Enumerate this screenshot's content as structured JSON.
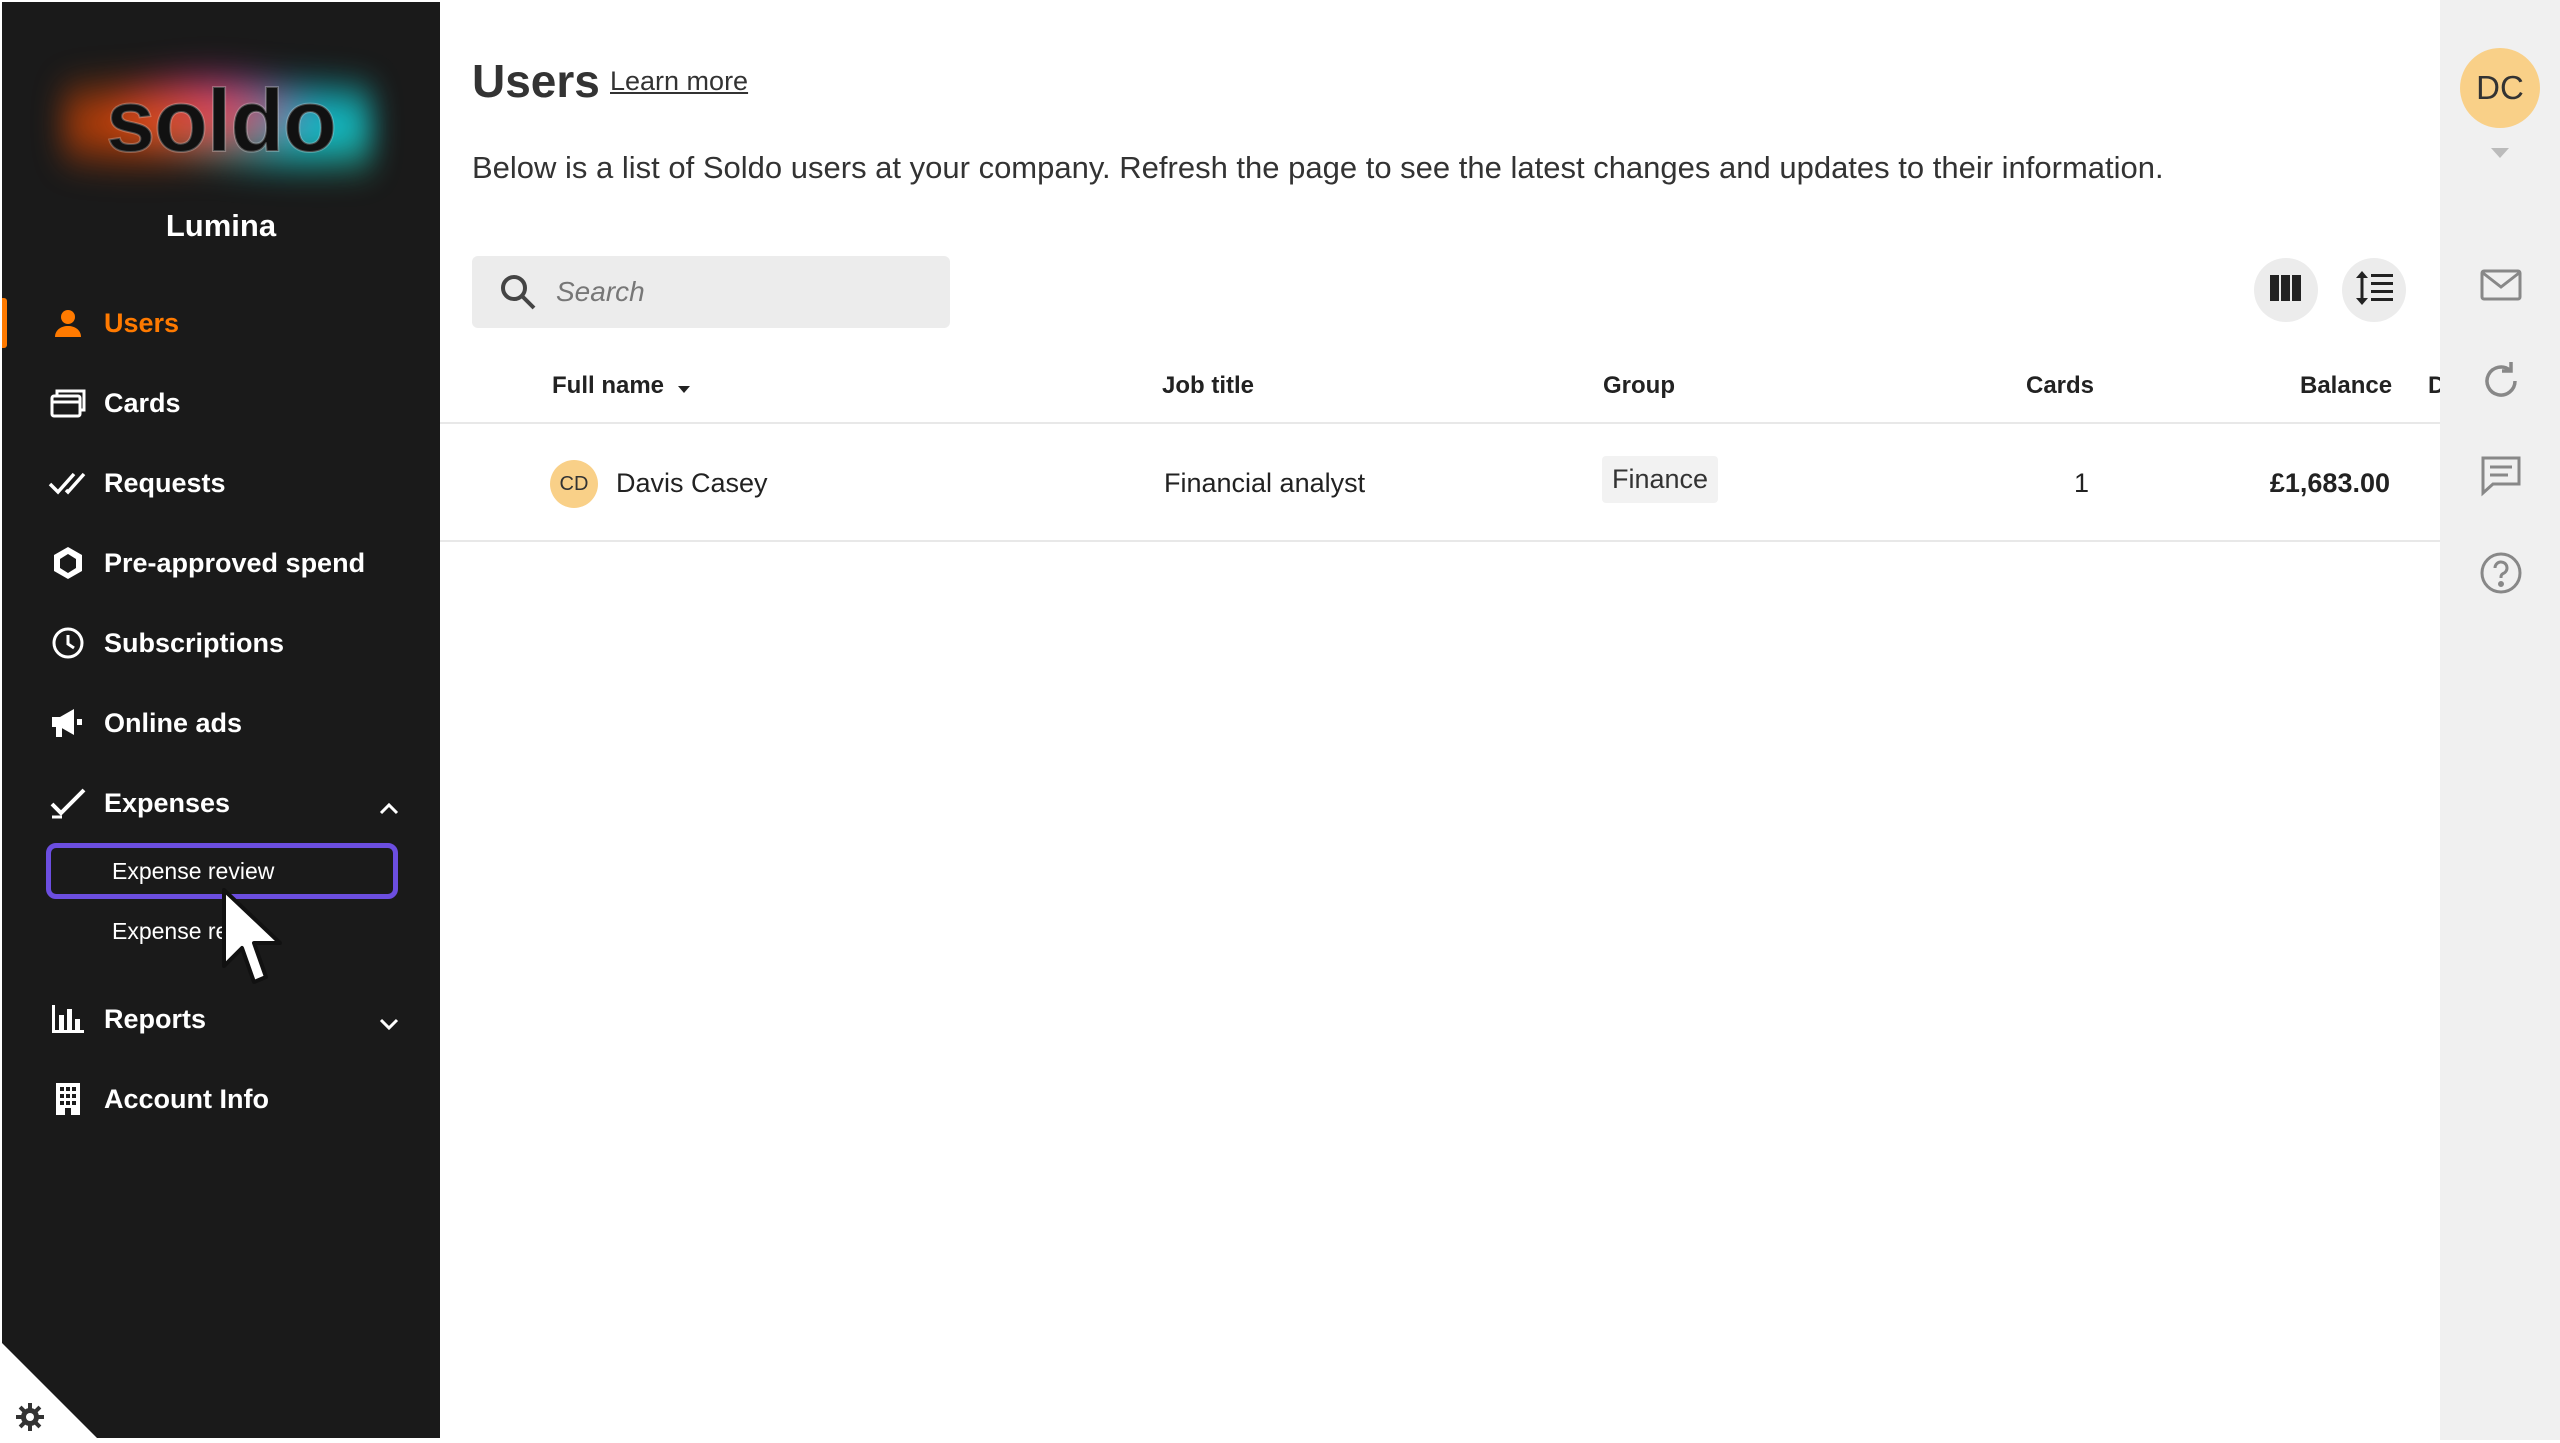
{
  "sidebar": {
    "logo_text": "soldo",
    "org_name": "Lumina",
    "items": [
      {
        "label": "Users",
        "icon": "user-icon",
        "active": true
      },
      {
        "label": "Cards",
        "icon": "cards-icon"
      },
      {
        "label": "Requests",
        "icon": "double-check-icon"
      },
      {
        "label": "Pre-approved spend",
        "icon": "hexagon-icon"
      },
      {
        "label": "Subscriptions",
        "icon": "clock-icon"
      },
      {
        "label": "Online ads",
        "icon": "megaphone-icon"
      },
      {
        "label": "Expenses",
        "icon": "check-icon",
        "expanded": true
      },
      {
        "label": "Reports",
        "icon": "bar-chart-icon",
        "expanded": false
      },
      {
        "label": "Account Info",
        "icon": "building-icon"
      }
    ],
    "expenses_sub": [
      {
        "label": "Expense review"
      },
      {
        "label": "Expense re"
      }
    ],
    "settings_icon": "gear-icon"
  },
  "main": {
    "title": "Users",
    "learn_more": "Learn more",
    "description": "Below is a list of Soldo users at your company. Refresh the page to see the latest changes and updates to their information.",
    "search": {
      "placeholder": "Search",
      "icon": "search-icon"
    },
    "toolbar": {
      "columns_icon": "columns-icon",
      "density_icon": "row-density-icon"
    },
    "table": {
      "columns": [
        "Full name",
        "Job title",
        "Group",
        "Cards",
        "Balance",
        "D"
      ],
      "sort_column": "Full name",
      "rows": [
        {
          "initials": "CD",
          "full_name": "Davis Casey",
          "job_title": "Financial analyst",
          "group": "Finance",
          "cards": "1",
          "balance": "£1,683.00"
        }
      ]
    }
  },
  "rail": {
    "avatar_initials": "DC",
    "icons": [
      "mail-icon",
      "refresh-icon",
      "chat-icon",
      "help-icon"
    ]
  },
  "colors": {
    "accent": "#ff7a00",
    "sidebar_bg": "#1a1a1a",
    "focus_ring": "#6c4ee0",
    "avatar_bg": "#f9d088"
  }
}
